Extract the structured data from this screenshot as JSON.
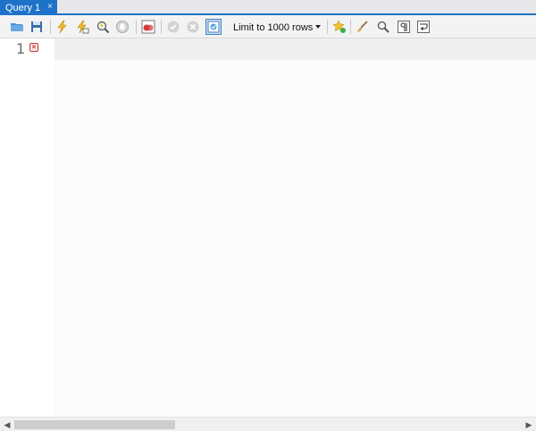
{
  "tab": {
    "label": "Query 1",
    "close_glyph": "×"
  },
  "toolbar": {
    "icons": [
      "open-folder-icon",
      "save-icon",
      "execute-icon",
      "execute-current-icon",
      "explain-icon",
      "stop-icon",
      "toggle-continue-on-error-icon",
      "commit-icon",
      "rollback-icon",
      "toggle-autocommit-icon",
      "add-snippet-icon",
      "beautify-icon",
      "find-icon",
      "invisible-chars-icon",
      "word-wrap-icon"
    ],
    "limit_select": {
      "value": "Limit to 1000 rows"
    }
  },
  "editor": {
    "line_number": "1",
    "error_glyph": "×"
  },
  "scrollbar": {
    "left_glyph": "◀",
    "right_glyph": "▶"
  },
  "colors": {
    "accent": "#1e73c8",
    "toolbar_bg": "#f3f3f3",
    "current_line": "#efefef"
  }
}
